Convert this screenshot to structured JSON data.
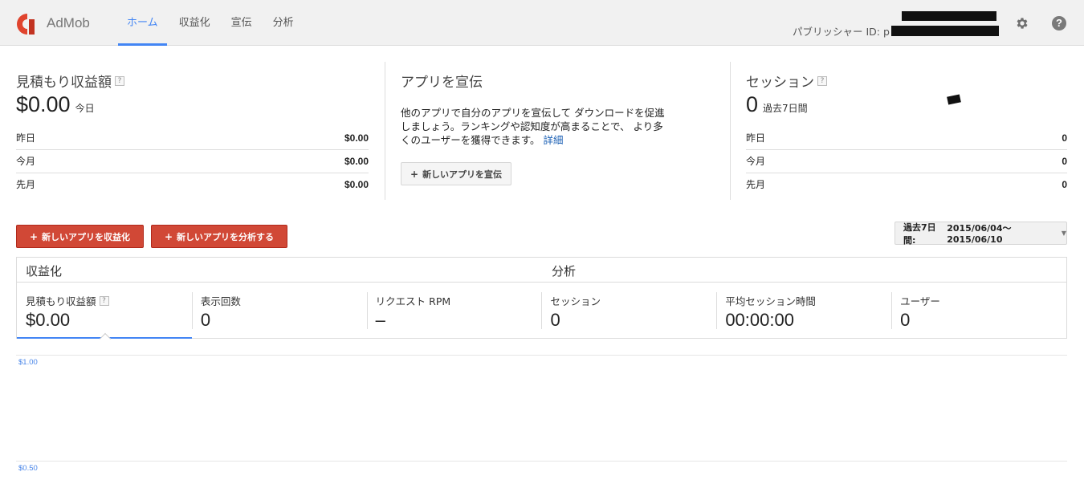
{
  "header": {
    "brand": "AdMob",
    "nav": [
      {
        "label": "ホーム",
        "active": true
      },
      {
        "label": "収益化",
        "active": false
      },
      {
        "label": "宣伝",
        "active": false
      },
      {
        "label": "分析",
        "active": false
      }
    ],
    "publisher_label": "パブリッシャー ID: p",
    "help_glyph": "?"
  },
  "earnings": {
    "title": "見積もり収益額",
    "value": "$0.00",
    "suffix": "今日",
    "rows": [
      {
        "label": "昨日",
        "value": "$0.00"
      },
      {
        "label": "今月",
        "value": "$0.00"
      },
      {
        "label": "先月",
        "value": "$0.00"
      }
    ]
  },
  "promote": {
    "title": "アプリを宣伝",
    "text": "他のアプリで自分のアプリを宣伝して ダウンロードを促進しましょう。ランキングや認知度が高まることで、 より多くのユーザーを獲得できます。",
    "link": "詳細",
    "button": "新しいアプリを宣伝"
  },
  "sessions": {
    "title": "セッション",
    "value": "0",
    "suffix": "過去7日間",
    "rows": [
      {
        "label": "昨日",
        "value": "0"
      },
      {
        "label": "今月",
        "value": "0"
      },
      {
        "label": "先月",
        "value": "0"
      }
    ]
  },
  "actions": {
    "monetize": "新しいアプリを収益化",
    "analyze": "新しいアプリを分析する",
    "date_prefix": "過去7日間:",
    "date_range": "2015/06/04〜2015/06/10"
  },
  "metrics_card": {
    "monetize_heading": "収益化",
    "analytics_heading": "分析",
    "metrics": [
      {
        "label": "見積もり収益額",
        "value": "$0.00"
      },
      {
        "label": "表示回数",
        "value": "0"
      },
      {
        "label": "リクエスト RPM",
        "value": "–"
      },
      {
        "label": "セッション",
        "value": "0"
      },
      {
        "label": "平均セッション時間",
        "value": "00:00:00"
      },
      {
        "label": "ユーザー",
        "value": "0"
      }
    ]
  },
  "chart_data": {
    "type": "line",
    "y_ticks": [
      "$1.00",
      "$0.50"
    ],
    "ylim": [
      0,
      1
    ],
    "series": []
  },
  "colors": {
    "accent": "#4285f4",
    "action_red": "#d14836",
    "tick_blue": "#4a86e8"
  },
  "icons": {
    "logo": "admob-logo-icon",
    "settings": "gear-icon",
    "help": "help-icon",
    "plus": "plus-icon",
    "dropdown": "caret-down-icon",
    "info": "question-mark-icon"
  }
}
